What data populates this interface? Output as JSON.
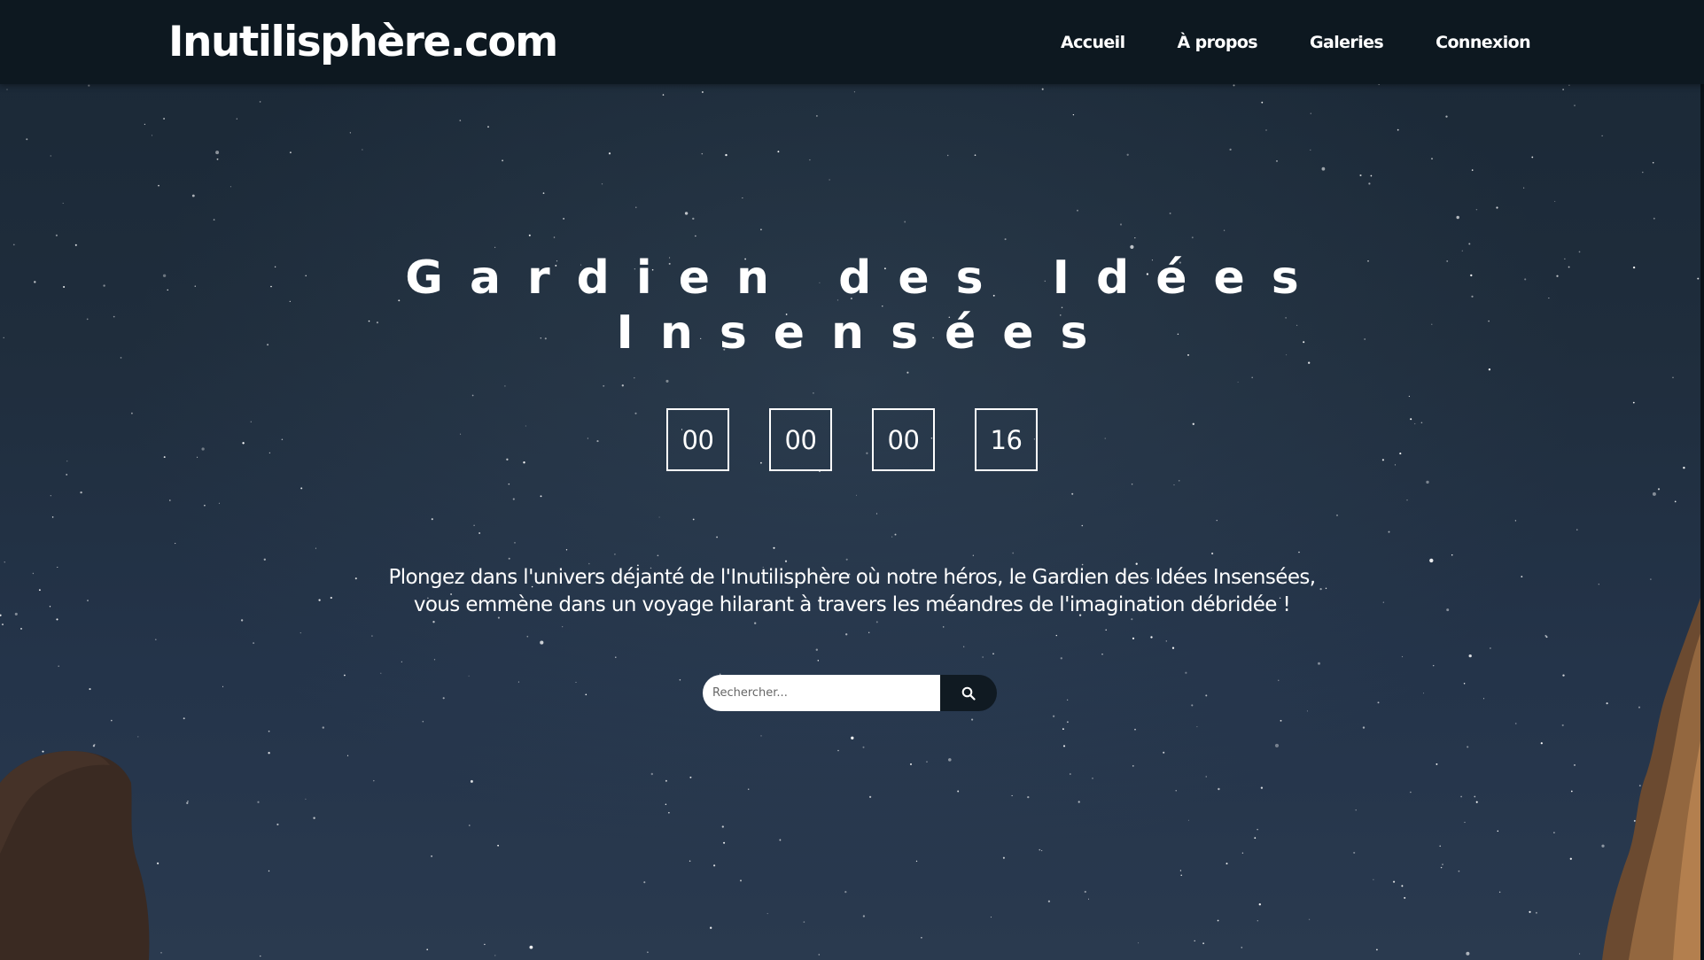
{
  "site": {
    "logo": "Inutilisphère.com"
  },
  "nav": {
    "items": [
      {
        "label": "Accueil"
      },
      {
        "label": "À propos"
      },
      {
        "label": "Galeries"
      },
      {
        "label": "Connexion"
      }
    ]
  },
  "hero": {
    "title_line1": "Gardien des Idées",
    "title_line2": "Insensées",
    "countdown": [
      "00",
      "00",
      "00",
      "16"
    ],
    "intro_line1": "Plongez dans l'univers déjanté de l'Inutilisphère où notre héros, le Gardien des Idées Insensées,",
    "intro_line2": "vous emmène dans un voyage hilarant à travers les méandres de l'imagination débridée !"
  },
  "search": {
    "placeholder": "Rechercher...",
    "icon": "search-icon"
  },
  "colors": {
    "header_bg": "#0d1820",
    "sky": "#1f2d3c",
    "text": "#ffffff",
    "search_button_bg": "#101a22"
  }
}
